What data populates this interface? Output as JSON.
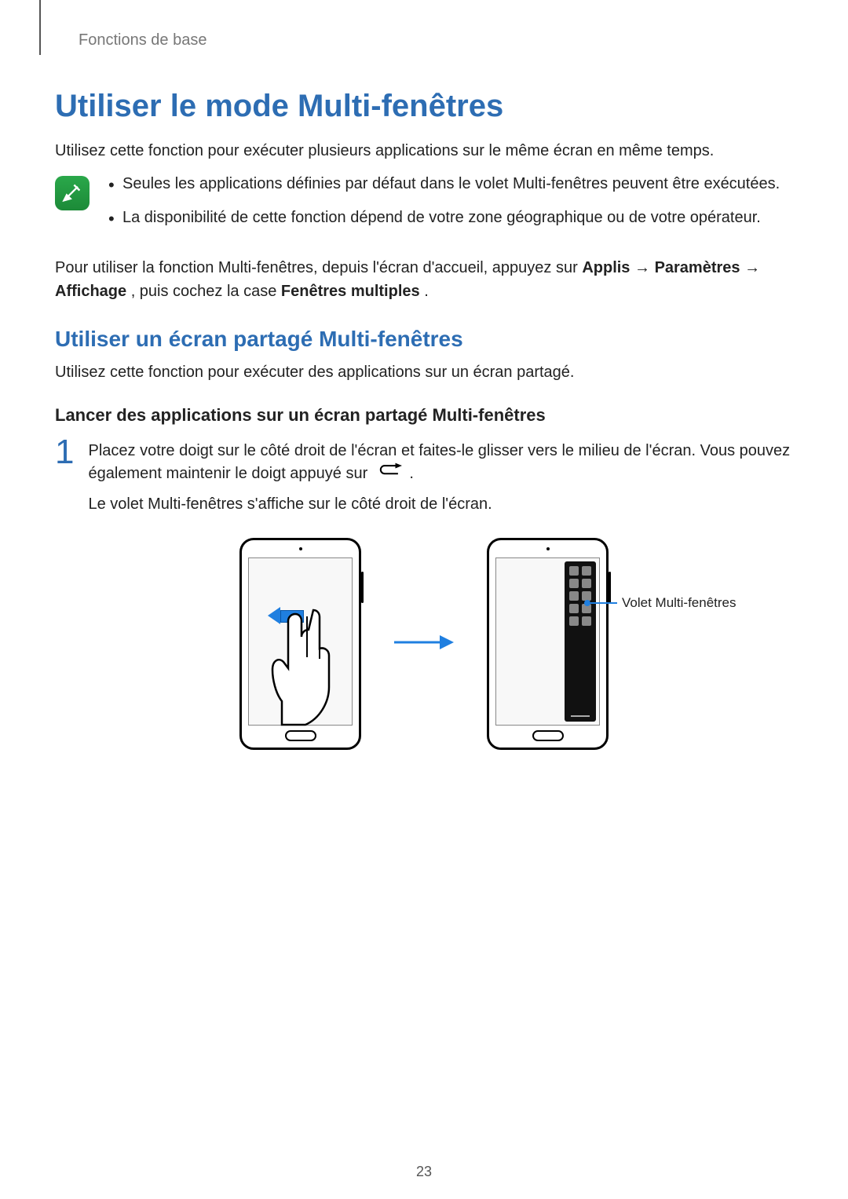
{
  "breadcrumb": "Fonctions de base",
  "title": "Utiliser le mode Multi-fenêtres",
  "intro": "Utilisez cette fonction pour exécuter plusieurs applications sur le même écran en même temps.",
  "notes": [
    "Seules les applications définies par défaut dans le volet Multi-fenêtres peuvent être exécutées.",
    "La disponibilité de cette fonction dépend de votre zone géographique ou de votre opérateur."
  ],
  "usage": {
    "prefix": "Pour utiliser la fonction Multi-fenêtres, depuis l'écran d'accueil, appuyez sur ",
    "b1": "Applis",
    "arrow1": " → ",
    "b2": "Paramètres",
    "arrow2": " → ",
    "b3": "Affichage",
    "mid": ", puis cochez la case ",
    "b4": "Fenêtres multiples",
    "end": "."
  },
  "subtitle": "Utiliser un écran partagé Multi-fenêtres",
  "subtitle_desc": "Utilisez cette fonction pour exécuter des applications sur un écran partagé.",
  "subsub": "Lancer des applications sur un écran partagé Multi-fenêtres",
  "step": {
    "num": "1",
    "line1a": "Placez votre doigt sur le côté droit de l'écran et faites-le glisser vers le milieu de l'écran. Vous pouvez également maintenir le doigt appuyé sur ",
    "line1b": ".",
    "line2": "Le volet Multi-fenêtres s'affiche sur le côté droit de l'écran."
  },
  "figure": {
    "callout": "Volet Multi-fenêtres"
  },
  "page_number": "23"
}
